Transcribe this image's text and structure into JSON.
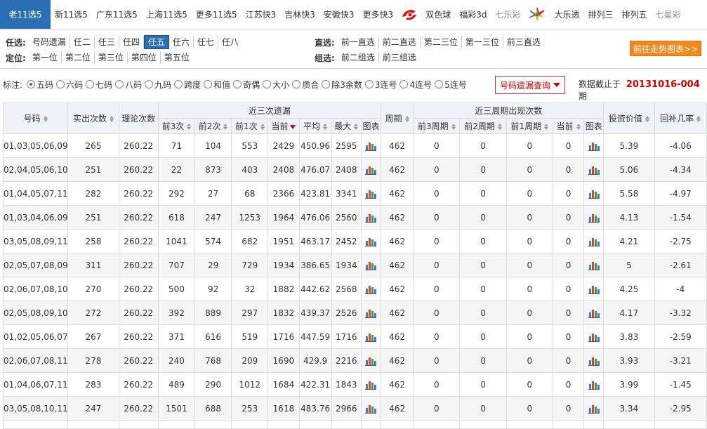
{
  "nav": {
    "items": [
      {
        "label": "老11选5",
        "active": true
      },
      {
        "label": "新11选5"
      },
      {
        "label": "广东11选5"
      },
      {
        "label": "上海11选5"
      },
      {
        "label": "更多11选5"
      },
      {
        "label": "江苏快3"
      },
      {
        "label": "吉林快3"
      },
      {
        "label": "安徽快3"
      },
      {
        "label": "更多快3"
      }
    ],
    "welfare_items": [
      {
        "label": "双色球"
      },
      {
        "label": "福彩3d"
      },
      {
        "label": "七乐彩",
        "muted": true
      }
    ],
    "sports_items": [
      {
        "label": "大乐透"
      },
      {
        "label": "排列三"
      },
      {
        "label": "排列五"
      },
      {
        "label": "七星彩",
        "muted": true
      }
    ]
  },
  "filters": {
    "renxuan": {
      "label": "任选:",
      "options": [
        "号码遗漏",
        "任二",
        "任三",
        "任四",
        "任五",
        "任六",
        "任七",
        "任八"
      ],
      "active": 4
    },
    "dingwei": {
      "label": "定位:",
      "options": [
        "第一位",
        "第二位",
        "第三位",
        "第四位",
        "第五位"
      ]
    },
    "zhixuan": {
      "label": "直选:",
      "options": [
        "前一直选",
        "前二直选",
        "第二三位",
        "第一三位",
        "前三直选"
      ]
    },
    "zuxuan": {
      "label": "组选:",
      "options": [
        "前二组选",
        "前三组选"
      ]
    },
    "trend_button": "前往走势图表>>"
  },
  "markers": {
    "label": "标注:",
    "options": [
      "五码",
      "六码",
      "七码",
      "八码",
      "九码",
      "跨度",
      "和值",
      "奇偶",
      "大小",
      "质合",
      "除3余数",
      "3连号",
      "4连号",
      "5连号"
    ],
    "checked": 0
  },
  "query": {
    "label": "号码遗漏查询"
  },
  "deadline": {
    "prefix": "数据截止于",
    "value": "20131016-004",
    "suffix": "期"
  },
  "table": {
    "header": {
      "code": "号码",
      "actual": "实出次数",
      "theory": "理论次数",
      "recent3": "近三次遗漏",
      "prev3": "前3次",
      "prev2": "前2次",
      "prev1": "前1次",
      "current": "当前",
      "avg": "平均",
      "max": "最大",
      "chart": "图表",
      "period": "周期",
      "recent3cycles": "近三周期出现次数",
      "c3": "前3周期",
      "c2": "前2周期",
      "c1": "前1周期",
      "ccur": "当前",
      "chart2": "图表",
      "invest": "投资价值",
      "payback": "回补几率"
    },
    "rows": [
      [
        "01,03,05,06,09",
        "265",
        "260.22",
        "71",
        "104",
        "553",
        "2429",
        "450.96",
        "2595",
        "462",
        "0",
        "0",
        "0",
        "0",
        "5.39",
        "-4.06"
      ],
      [
        "02,04,05,06,10",
        "251",
        "260.22",
        "22",
        "873",
        "403",
        "2408",
        "476.07",
        "2408",
        "462",
        "0",
        "0",
        "0",
        "0",
        "5.06",
        "-4.34"
      ],
      [
        "01,04,05,07,11",
        "282",
        "260.22",
        "292",
        "27",
        "68",
        "2366",
        "423.81",
        "3341",
        "462",
        "0",
        "0",
        "0",
        "0",
        "5.58",
        "-4.97"
      ],
      [
        "01,03,04,06,09",
        "251",
        "260.22",
        "618",
        "247",
        "1253",
        "1964",
        "476.06",
        "2560",
        "462",
        "0",
        "0",
        "0",
        "0",
        "4.13",
        "-1.54"
      ],
      [
        "03,05,08,09,11",
        "258",
        "260.22",
        "1041",
        "574",
        "682",
        "1951",
        "463.17",
        "2452",
        "462",
        "0",
        "0",
        "0",
        "0",
        "4.21",
        "-2.75"
      ],
      [
        "02,05,07,08,09",
        "311",
        "260.22",
        "707",
        "29",
        "729",
        "1934",
        "386.65",
        "1934",
        "462",
        "0",
        "0",
        "0",
        "0",
        "5",
        "-2.61"
      ],
      [
        "02,06,07,08,10",
        "270",
        "260.22",
        "500",
        "92",
        "32",
        "1882",
        "442.62",
        "2568",
        "462",
        "0",
        "0",
        "0",
        "0",
        "4.25",
        "-4"
      ],
      [
        "02,05,08,09,10",
        "272",
        "260.22",
        "392",
        "889",
        "297",
        "1832",
        "439.37",
        "2526",
        "462",
        "0",
        "0",
        "0",
        "0",
        "4.17",
        "-3.32"
      ],
      [
        "01,02,05,06,07",
        "267",
        "260.22",
        "371",
        "616",
        "519",
        "1716",
        "447.59",
        "1716",
        "462",
        "0",
        "0",
        "0",
        "0",
        "3.83",
        "-2.59"
      ],
      [
        "02,06,07,08,11",
        "278",
        "260.22",
        "240",
        "768",
        "209",
        "1690",
        "429.9",
        "2216",
        "462",
        "0",
        "0",
        "0",
        "0",
        "3.93",
        "-3.21"
      ],
      [
        "01,04,06,07,11",
        "283",
        "260.22",
        "489",
        "290",
        "1012",
        "1684",
        "422.31",
        "1843",
        "462",
        "0",
        "0",
        "0",
        "0",
        "3.99",
        "-1.45"
      ],
      [
        "03,05,08,10,11",
        "247",
        "260.22",
        "1501",
        "688",
        "253",
        "1618",
        "483.76",
        "2966",
        "462",
        "0",
        "0",
        "0",
        "0",
        "3.34",
        "-2.95"
      ]
    ]
  },
  "colors": {
    "accent": "#2a6fb4",
    "orange": "#f2891f",
    "red": "#cc0000",
    "header_bg": "#eef3f9"
  }
}
